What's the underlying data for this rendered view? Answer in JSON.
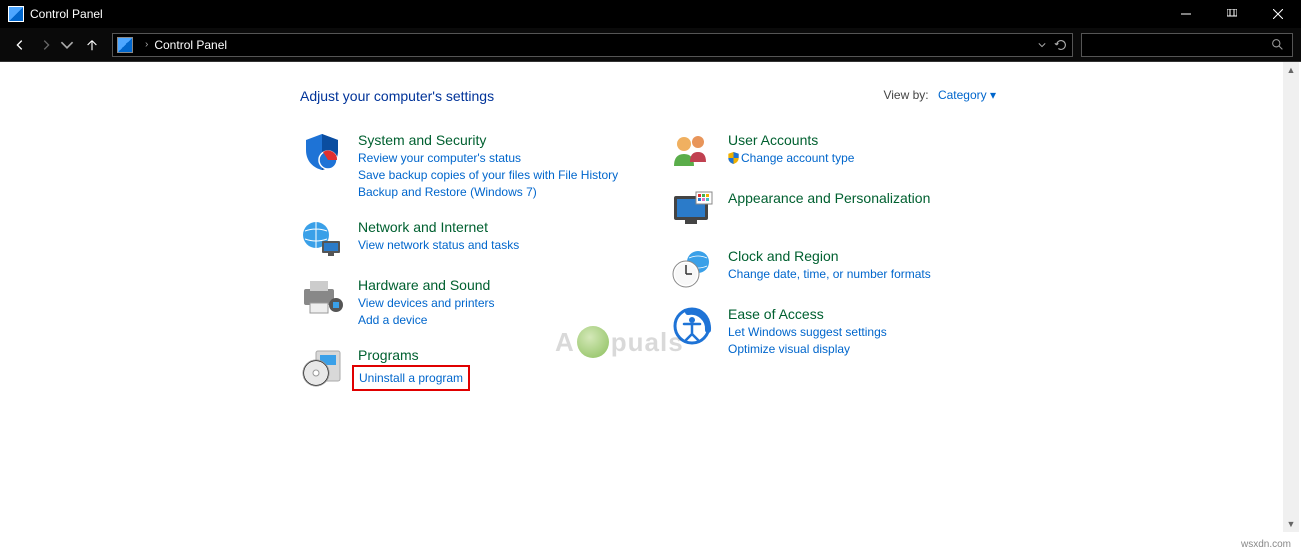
{
  "window": {
    "title": "Control Panel"
  },
  "address": {
    "location": "Control Panel"
  },
  "heading": "Adjust your computer's settings",
  "viewby": {
    "label": "View by:",
    "value": "Category"
  },
  "left": [
    {
      "title": "System and Security",
      "links": [
        "Review your computer's status",
        "Save backup copies of your files with File History",
        "Backup and Restore (Windows 7)"
      ]
    },
    {
      "title": "Network and Internet",
      "links": [
        "View network status and tasks"
      ]
    },
    {
      "title": "Hardware and Sound",
      "links": [
        "View devices and printers",
        "Add a device"
      ]
    },
    {
      "title": "Programs",
      "links": [
        "Uninstall a program"
      ]
    }
  ],
  "right": [
    {
      "title": "User Accounts",
      "links": [
        "Change account type"
      ]
    },
    {
      "title": "Appearance and Personalization",
      "links": []
    },
    {
      "title": "Clock and Region",
      "links": [
        "Change date, time, or number formats"
      ]
    },
    {
      "title": "Ease of Access",
      "links": [
        "Let Windows suggest settings",
        "Optimize visual display"
      ]
    }
  ],
  "watermark": {
    "pre": "A",
    "post": "puals"
  },
  "footer": "wsxdn.com"
}
